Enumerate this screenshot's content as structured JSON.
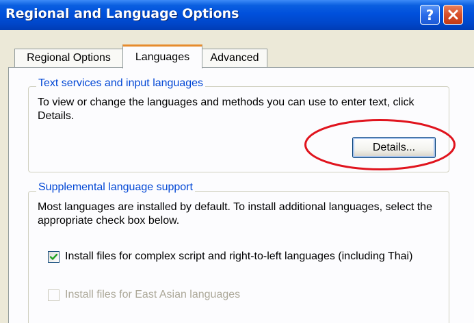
{
  "window": {
    "title": "Regional and Language Options",
    "help_button": "?",
    "close_button_icon": "close-icon"
  },
  "tabs": [
    {
      "label": "Regional Options",
      "selected": false
    },
    {
      "label": "Languages",
      "selected": true
    },
    {
      "label": "Advanced",
      "selected": false
    }
  ],
  "text_services": {
    "legend": "Text services and input languages",
    "description": "To view or change the languages and methods you can use to enter text, click Details.",
    "details_button": "Details..."
  },
  "supplemental": {
    "legend": "Supplemental language support",
    "description": "Most languages are installed by default. To install additional languages, select the appropriate check box below.",
    "checkboxes": [
      {
        "label": "Install files for complex script and right-to-left languages (including Thai)",
        "checked": true,
        "enabled": true
      },
      {
        "label": "Install files for East Asian languages",
        "checked": false,
        "enabled": false
      }
    ]
  },
  "colors": {
    "titlebar": "#0050dc",
    "group_legend": "#0046d5",
    "annotation_ellipse": "#e0141e",
    "selected_tab_accent": "#e68b2c"
  }
}
